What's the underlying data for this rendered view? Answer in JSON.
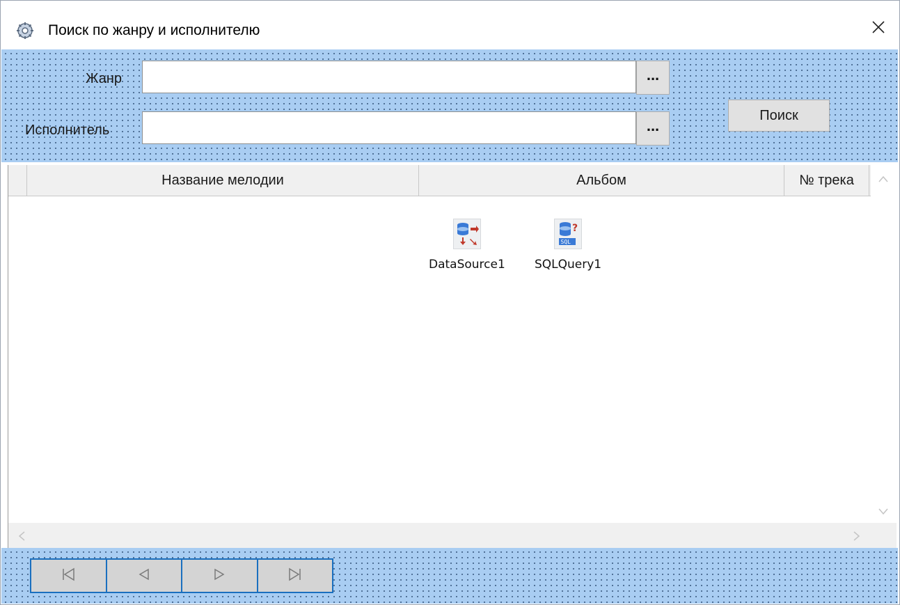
{
  "window": {
    "title": "Поиск по жанру и исполнителю",
    "title_icon": "form-gear-icon",
    "close_icon": "close-icon"
  },
  "search": {
    "genre_label": "Жанр",
    "genre_value": "",
    "artist_label": "Исполнитель",
    "artist_value": "",
    "ellipsis_label": "...",
    "search_button": "Поиск"
  },
  "grid": {
    "columns": [
      "Название мелодии",
      "Альбом",
      "№ трека"
    ],
    "rows": []
  },
  "components": [
    {
      "name": "DataSource1",
      "icon": "datasource-icon"
    },
    {
      "name": "SQLQuery1",
      "icon": "sqlquery-icon"
    }
  ],
  "navigator": {
    "buttons": [
      "first-icon",
      "prior-icon",
      "next-icon",
      "last-icon"
    ]
  },
  "colors": {
    "panel_bg": "#a9cdf2",
    "nav_border": "#1a6fbf"
  }
}
